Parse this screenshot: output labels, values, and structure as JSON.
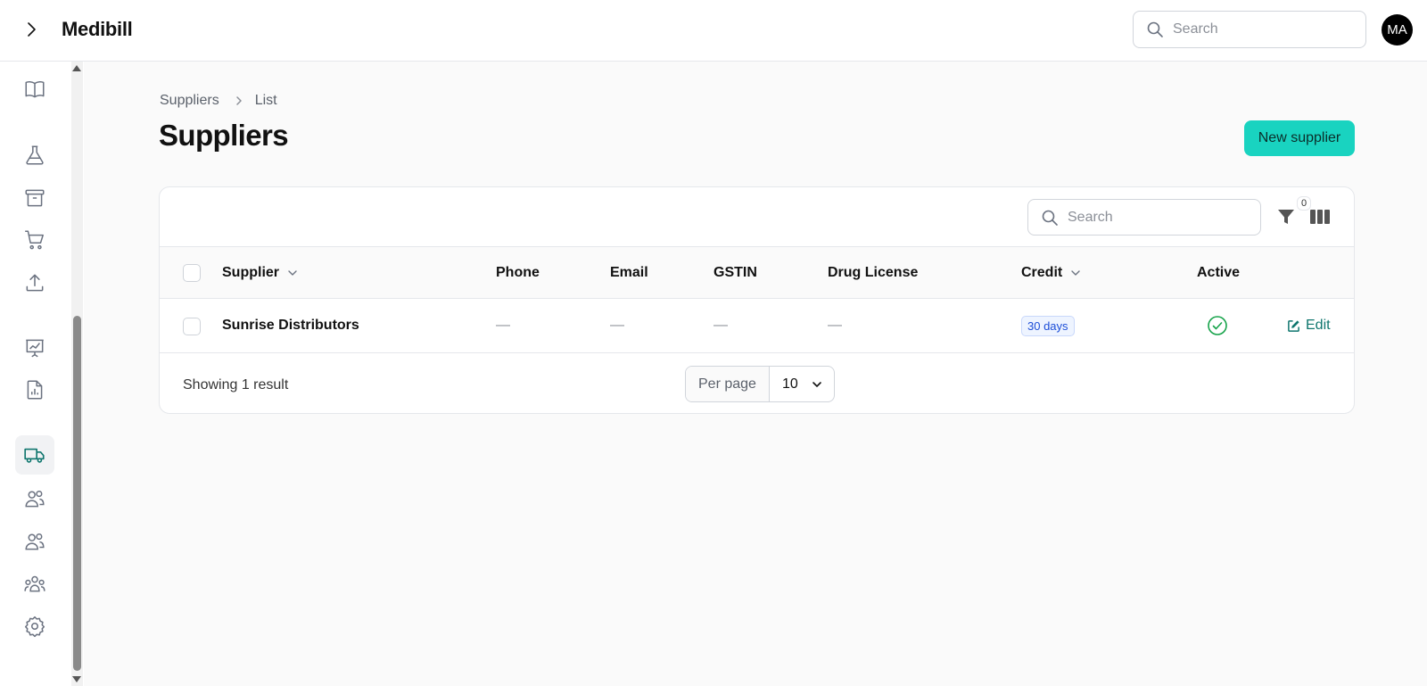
{
  "app": {
    "brand": "Medibill"
  },
  "header": {
    "search_placeholder": "Search",
    "avatar_initials": "MA"
  },
  "sidebar": {
    "items": [
      {
        "icon": "book-open-icon"
      },
      {
        "icon": "flask-icon"
      },
      {
        "icon": "archive-box-icon"
      },
      {
        "icon": "shopping-cart-icon"
      },
      {
        "icon": "upload-icon"
      },
      {
        "icon": "presentation-chart-icon"
      },
      {
        "icon": "document-chart-icon"
      },
      {
        "icon": "truck-icon",
        "active": true
      },
      {
        "icon": "users-icon"
      },
      {
        "icon": "user-group-icon"
      },
      {
        "icon": "team-icon"
      },
      {
        "icon": "gear-icon"
      }
    ]
  },
  "breadcrumb": {
    "parent": "Suppliers",
    "current": "List"
  },
  "page": {
    "title": "Suppliers",
    "new_button": "New supplier"
  },
  "table": {
    "search_placeholder": "Search",
    "filter_count": "0",
    "columns": [
      "Supplier",
      "Phone",
      "Email",
      "GSTIN",
      "Drug License",
      "Credit",
      "Active"
    ],
    "rows": [
      {
        "supplier": "Sunrise Distributors",
        "phone": "—",
        "email": "—",
        "gstin": "—",
        "drug_license": "—",
        "credit": "30 days",
        "active": true,
        "action": "Edit"
      }
    ],
    "footer": {
      "showing": "Showing 1 result",
      "per_page_label": "Per page",
      "per_page_value": "10"
    }
  },
  "colors": {
    "accent": "#19d3c0",
    "active_green": "#16a34a",
    "link": "#0f766e",
    "badge_blue": "#1d4ed8"
  }
}
